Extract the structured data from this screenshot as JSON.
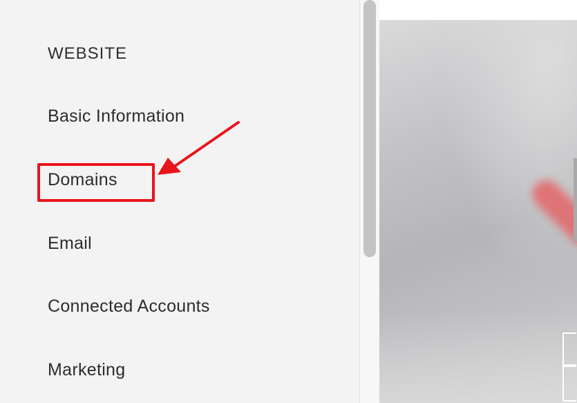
{
  "sidebar": {
    "heading": "WEBSITE",
    "items": [
      {
        "label": "Basic Information"
      },
      {
        "label": "Domains",
        "highlighted": true
      },
      {
        "label": "Email"
      },
      {
        "label": "Connected Accounts"
      },
      {
        "label": "Marketing"
      }
    ]
  },
  "annotation": {
    "highlight_color": "#e8141b"
  },
  "colors": {
    "sidebar_background": "#f3f3f3",
    "text": "#2c2c2c"
  }
}
